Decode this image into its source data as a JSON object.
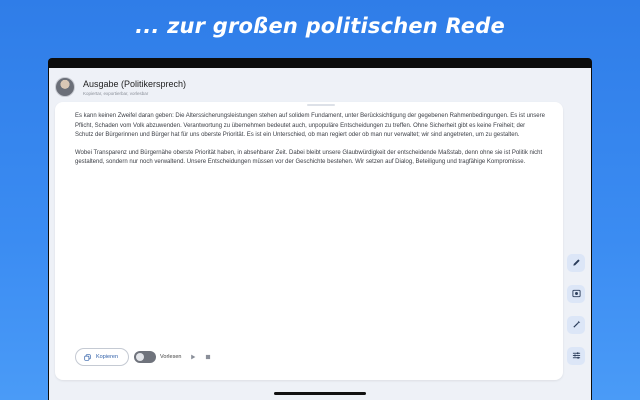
{
  "headline": "... zur großen politischen Rede",
  "header": {
    "title": "Ausgabe (Politikersprech)",
    "subtitle": "Kopiertar, exportierbar, vorlesbar"
  },
  "output": {
    "paragraphs": [
      "Es kann keinen Zweifel daran geben: Die Alterssicherungsleistungen stehen auf solidem Fundament, unter Berücksichtigung der gegebenen Rahmenbedingungen. Es ist unsere Pflicht, Schaden vom Volk abzuwenden. Verantwortung zu übernehmen bedeutet auch, unpopuläre Entscheidungen zu treffen. Ohne Sicherheit gibt es keine Freiheit; der Schutz der Bürgerinnen und Bürger hat für uns oberste Priorität. Es ist ein Unterschied, ob man regiert oder ob man nur verwaltet; wir sind angetreten, um zu gestalten.",
      "Wobei Transparenz und Bürgernähe oberste Priorität haben, in absehbarer Zeit. Dabei bleibt unsere Glaubwürdigkeit der entscheidende Maßstab, denn ohne sie ist Politik nicht gestaltend, sondern nur noch verwaltend. Unsere Entscheidungen müssen vor der Geschichte bestehen. Wir setzen auf Dialog, Beteiligung und tragfähige Kompromisse."
    ]
  },
  "controls": {
    "copy_label": "Kopieren",
    "read_aloud_label": "Vorlesen"
  },
  "icons": {
    "copy": "copy-icon",
    "play": "play-icon",
    "stop": "stop-icon",
    "edit": "pencil-icon",
    "image": "image-icon",
    "magic": "magic-wand-icon",
    "settings": "tune-icon"
  },
  "colors": {
    "background": "#3b8cf2",
    "accent": "#2f5fa8",
    "fab": "#dce6f7"
  }
}
